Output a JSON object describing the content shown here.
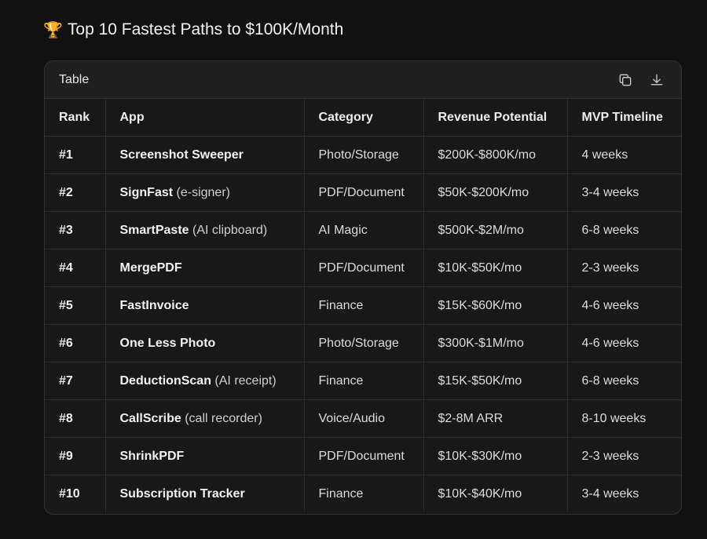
{
  "page": {
    "trophy_icon": "trophy-icon",
    "title": "Top 10 Fastest Paths to $100K/Month"
  },
  "card": {
    "title": "Table",
    "copy_icon": "copy-icon",
    "download_icon": "download-icon"
  },
  "table": {
    "headers": [
      "Rank",
      "App",
      "Category",
      "Revenue Potential",
      "MVP Timeline"
    ],
    "rows": [
      {
        "rank": "#1",
        "app": "Screenshot Sweeper",
        "note": "",
        "category": "Photo/Storage",
        "revenue": "$200K-$800K/mo",
        "timeline": "4 weeks"
      },
      {
        "rank": "#2",
        "app": "SignFast",
        "note": "(e-signer)",
        "category": "PDF/Document",
        "revenue": "$50K-$200K/mo",
        "timeline": "3-4 weeks"
      },
      {
        "rank": "#3",
        "app": "SmartPaste",
        "note": "(AI clipboard)",
        "category": "AI Magic",
        "revenue": "$500K-$2M/mo",
        "timeline": "6-8 weeks"
      },
      {
        "rank": "#4",
        "app": "MergePDF",
        "note": "",
        "category": "PDF/Document",
        "revenue": "$10K-$50K/mo",
        "timeline": "2-3 weeks"
      },
      {
        "rank": "#5",
        "app": "FastInvoice",
        "note": "",
        "category": "Finance",
        "revenue": "$15K-$60K/mo",
        "timeline": "4-6 weeks"
      },
      {
        "rank": "#6",
        "app": "One Less Photo",
        "note": "",
        "category": "Photo/Storage",
        "revenue": "$300K-$1M/mo",
        "timeline": "4-6 weeks"
      },
      {
        "rank": "#7",
        "app": "DeductionScan",
        "note": "(AI receipt)",
        "category": "Finance",
        "revenue": "$15K-$50K/mo",
        "timeline": "6-8 weeks"
      },
      {
        "rank": "#8",
        "app": "CallScribe",
        "note": "(call recorder)",
        "category": "Voice/Audio",
        "revenue": "$2-8M ARR",
        "timeline": "8-10 weeks"
      },
      {
        "rank": "#9",
        "app": "ShrinkPDF",
        "note": "",
        "category": "PDF/Document",
        "revenue": "$10K-$30K/mo",
        "timeline": "2-3 weeks"
      },
      {
        "rank": "#10",
        "app": "Subscription Tracker",
        "note": "",
        "category": "Finance",
        "revenue": "$10K-$40K/mo",
        "timeline": "3-4 weeks"
      }
    ]
  }
}
